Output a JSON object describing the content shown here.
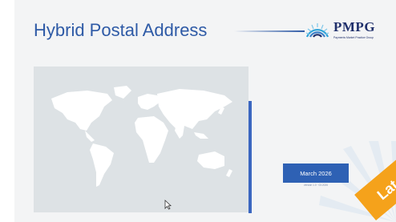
{
  "slide": {
    "title": "Hybrid Postal Address",
    "logo": {
      "wordmark": "PMPG",
      "tagline": "Payments Market Practice Group"
    },
    "date_badge": {
      "label": "March 2026",
      "sub": "version 1.0 · 03.2026"
    },
    "stamp_text": "Lat"
  },
  "colors": {
    "title": "#2e5aa6",
    "badge": "#2e61b4",
    "accent_bar": "#3a66c0",
    "map_panel": "#dde2e5",
    "stamp": "#f5a21b"
  },
  "icons": [
    "pmpg-logo-icon",
    "cursor-icon"
  ]
}
